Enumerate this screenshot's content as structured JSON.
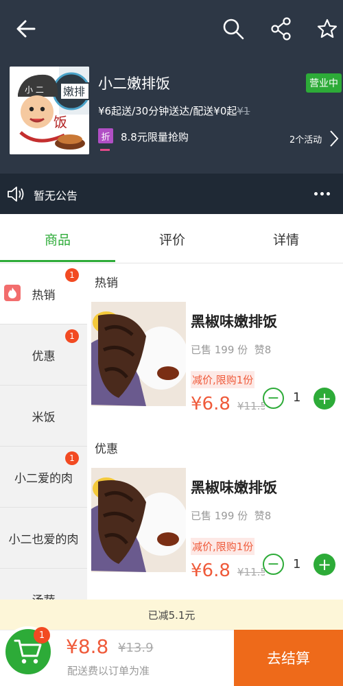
{
  "header": {
    "store_name": "小二嫩排饭",
    "status_badge": "营业中",
    "delivery_info": "¥6起送/30分钟送达/配送¥0起",
    "delivery_old_fee": "¥1",
    "promo_badge": "折",
    "promo_text": "8.8元限量抢购",
    "activities": "2个活动",
    "logo_text_1": "小 二",
    "logo_text_2": "嫩排",
    "logo_text_3": "饭"
  },
  "notice": {
    "text": "暂无公告"
  },
  "tabs": [
    {
      "label": "商品"
    },
    {
      "label": "评价"
    },
    {
      "label": "详情"
    }
  ],
  "sidebar": {
    "categories": [
      {
        "label": "热销",
        "badge": "1"
      },
      {
        "label": "优惠",
        "badge": "1"
      },
      {
        "label": "米饭",
        "badge": ""
      },
      {
        "label": "小二爱的肉",
        "badge": "1"
      },
      {
        "label": "小二也爱的肉",
        "badge": ""
      },
      {
        "label": "汤蔬",
        "badge": ""
      }
    ]
  },
  "sections": [
    {
      "title": "热销",
      "product": {
        "name": "黑椒味嫩排饭",
        "sold": "已售 199 份",
        "likes": "赞8",
        "tag": "减价,限购1份",
        "price": "¥6.8",
        "old_price": "¥11.5",
        "quantity": "1"
      }
    },
    {
      "title": "优惠",
      "product": {
        "name": "黑椒味嫩排饭",
        "sold": "已售 199 份",
        "likes": "赞8",
        "tag": "减价,限购1份",
        "price": "¥6.8",
        "old_price": "¥11.5",
        "quantity": "1"
      }
    }
  ],
  "discount_bar": {
    "text": "已减5.1元"
  },
  "footer": {
    "cart_badge": "1",
    "total": "¥8.8",
    "total_old": "¥13.9",
    "delivery_note": "配送费以订单为准",
    "checkout_label": "去结算"
  },
  "colors": {
    "header_bg": "#2d3745",
    "accent_green": "#2dab38",
    "price_red": "#ef5a3a",
    "checkout_orange": "#ee6a1a"
  },
  "icons": [
    "back-arrow-icon",
    "search-icon",
    "share-icon",
    "star-icon",
    "speaker-icon",
    "more-icon",
    "fire-icon",
    "cart-icon"
  ]
}
